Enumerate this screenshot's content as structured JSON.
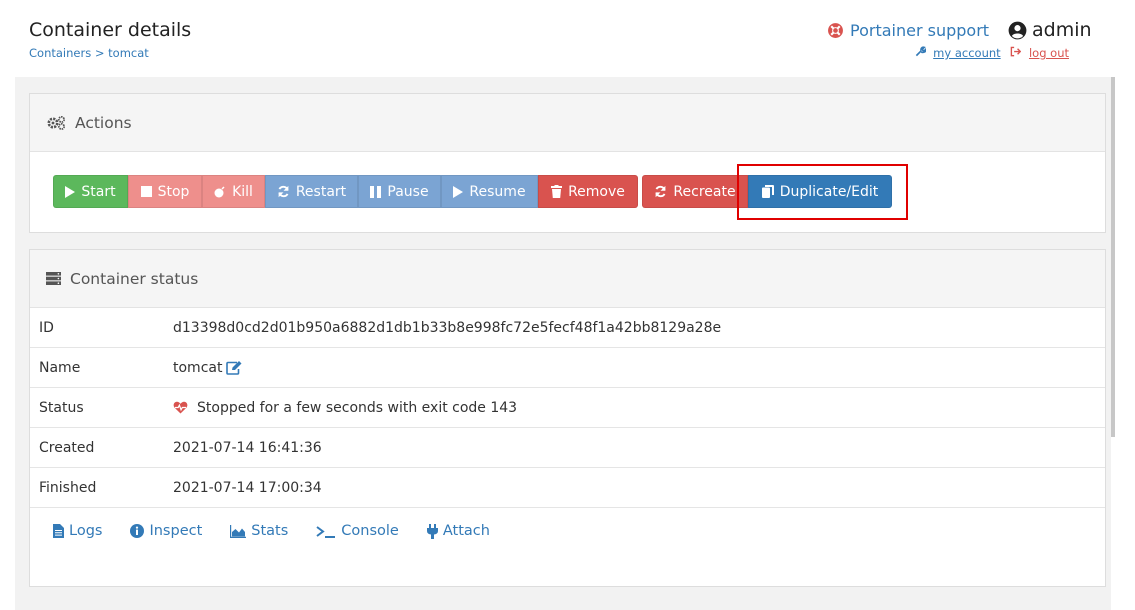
{
  "header": {
    "title": "Container details",
    "breadcrumb": {
      "parent": "Containers",
      "separator": ">",
      "current": "tomcat"
    },
    "support_label": "Portainer support",
    "user": "admin",
    "my_account": "my account",
    "log_out": "log out"
  },
  "actions": {
    "heading": "Actions",
    "buttons": {
      "start": "Start",
      "stop": "Stop",
      "kill": "Kill",
      "restart": "Restart",
      "pause": "Pause",
      "resume": "Resume",
      "remove": "Remove",
      "recreate": "Recreate",
      "duplicate": "Duplicate/Edit"
    }
  },
  "status": {
    "heading": "Container status",
    "rows": [
      {
        "label": "ID",
        "value": "d13398d0cd2d01b950a6882d1db1b33b8e998fc72e5fecf48f1a42bb8129a28e"
      },
      {
        "label": "Name",
        "value": "tomcat"
      },
      {
        "label": "Status",
        "value": "Stopped for a few seconds with exit code 143"
      },
      {
        "label": "Created",
        "value": "2021-07-14 16:41:36"
      },
      {
        "label": "Finished",
        "value": "2021-07-14 17:00:34"
      }
    ],
    "links": [
      "Logs",
      "Inspect",
      "Stats",
      "Console",
      "Attach"
    ]
  },
  "colors": {
    "link": "#337ab7",
    "success": "#5cb85c",
    "danger": "#d9534f",
    "danger_light": "#ee8f8c",
    "info_light": "#7ba4d3",
    "primary": "#337ab7",
    "highlight_box": "#e00000"
  },
  "icons": {
    "support": "life-ring-icon",
    "user": "user-circle-icon",
    "my_account": "wrench-icon",
    "log_out": "sign-out-icon",
    "actions": "cogs-icon",
    "status": "server-icon",
    "name_edit": "edit-icon",
    "status_indicator": "heartbeat-icon"
  }
}
